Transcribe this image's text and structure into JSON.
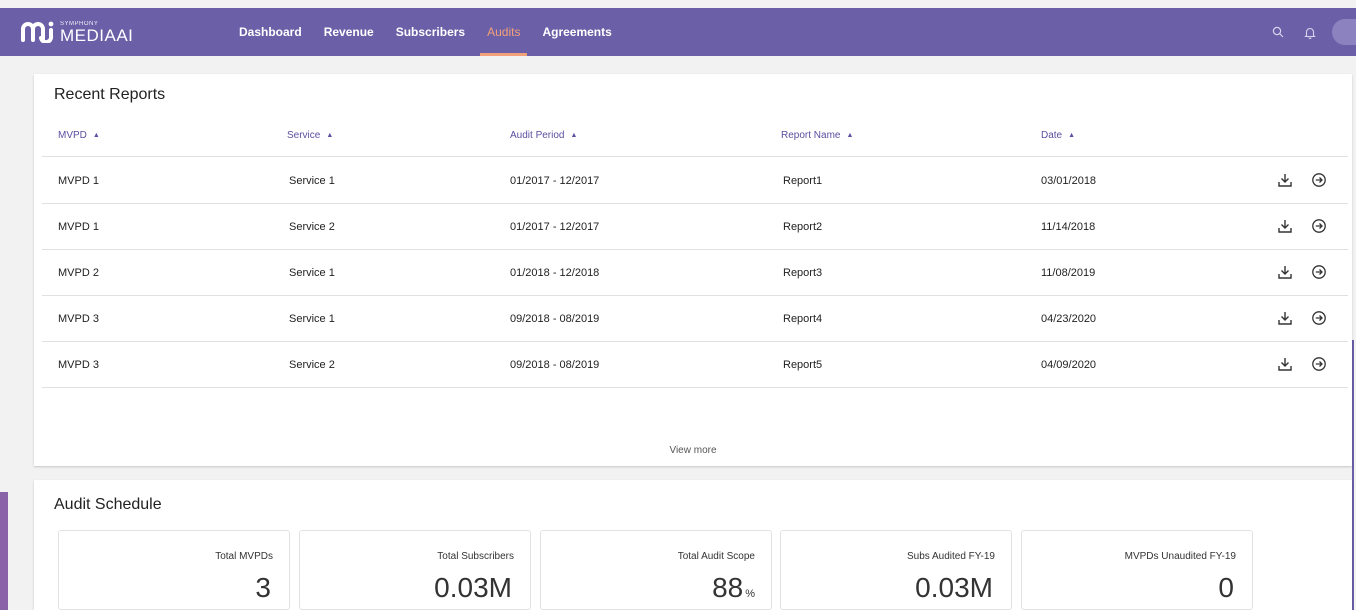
{
  "brand": {
    "small_text": "SYMPHONY",
    "name": "MEDIAAI",
    "logo_icon": "mj-logo-icon"
  },
  "nav": {
    "items": [
      {
        "label": "Dashboard",
        "active": false
      },
      {
        "label": "Revenue",
        "active": false
      },
      {
        "label": "Subscribers",
        "active": false
      },
      {
        "label": "Audits",
        "active": true
      },
      {
        "label": "Agreements",
        "active": false
      }
    ],
    "icons": [
      "search-icon",
      "bell-icon",
      "avatar"
    ]
  },
  "recent_reports": {
    "title": "Recent Reports",
    "columns": [
      "MVPD",
      "Service",
      "Audit Period",
      "Report Name",
      "Date"
    ],
    "rows": [
      [
        "MVPD 1",
        "Service 1",
        "01/2017 - 12/2017",
        "Report1",
        "03/01/2018"
      ],
      [
        "MVPD 1",
        "Service 2",
        "01/2017 - 12/2017",
        "Report2",
        "11/14/2018"
      ],
      [
        "MVPD 2",
        "Service 1",
        "01/2018 - 12/2018",
        "Report3",
        "11/08/2019"
      ],
      [
        "MVPD 3",
        "Service 1",
        "09/2018 - 08/2019",
        "Report4",
        "04/23/2020"
      ],
      [
        "MVPD 3",
        "Service 2",
        "09/2018 - 08/2019",
        "Report5",
        "04/09/2020"
      ]
    ],
    "row_actions": [
      "download-icon",
      "arrow-circle-right-icon"
    ],
    "view_more": "View more"
  },
  "audit_schedule": {
    "title": "Audit Schedule",
    "stats": [
      {
        "label": "Total MVPDs",
        "value": "3",
        "unit": ""
      },
      {
        "label": "Total Subscribers",
        "value": "0.03M",
        "unit": ""
      },
      {
        "label": "Total Audit Scope",
        "value": "88",
        "unit": "%"
      },
      {
        "label": "Subs Audited FY-19",
        "value": "0.03M",
        "unit": ""
      },
      {
        "label": "MVPDs Unaudited FY-19",
        "value": "0",
        "unit": ""
      }
    ]
  },
  "colors": {
    "nav_bg": "#6b5fa8",
    "active_tab": "#f2a07a",
    "column_header": "#5a4fa0"
  }
}
